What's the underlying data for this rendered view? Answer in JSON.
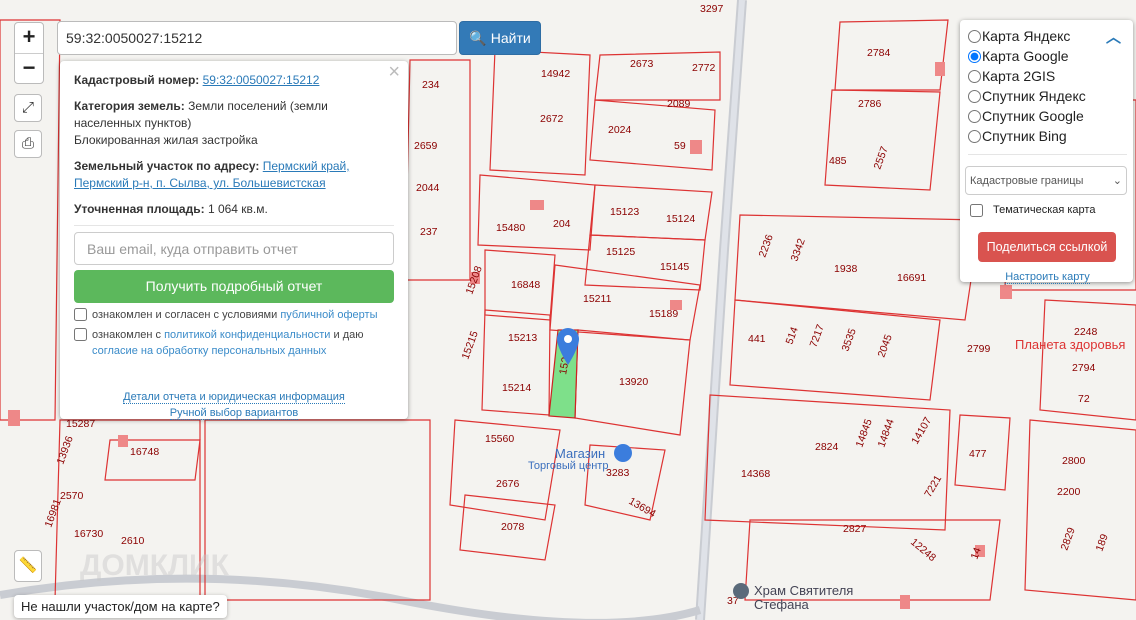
{
  "search": {
    "value": "59:32:0050027:15212",
    "button": "Найти"
  },
  "zoom": {
    "in": "+",
    "out": "−"
  },
  "popup": {
    "cad_label": "Кадастровый номер:",
    "cad_value": "59:32:0050027:15212",
    "cat_label": "Категория земель:",
    "cat_value": "Земли поселений (земли населенных пунктов)",
    "use": "Блокированная жилая застройка",
    "addr_label": "Земельный участок по адресу:",
    "addr_value": "Пермский край, Пермский р-н, п. Сылва, ул. Большевистская",
    "area_label": "Уточненная площадь:",
    "area_value": "1 064 кв.м.",
    "email_placeholder": "Ваш email, куда отправить отчет",
    "get_button": "Получить подробный отчет",
    "c1_text": "ознакомлен и согласен с условиями ",
    "c1_link": "публичной оферты",
    "c2_text": "ознакомлен с ",
    "c2_link": "политикой конфиденциальности",
    "c2_mid": " и даю ",
    "c2_link2": "согласие на обработку персональных данных",
    "details_link": "Детали отчета и юридическая информация",
    "manual_link": "Ручной выбор вариантов",
    "close": "×"
  },
  "layers": {
    "options": [
      "Карта Яндекс",
      "Карта Google",
      "Карта 2GIS",
      "Спутник Яндекс",
      "Спутник Google",
      "Спутник Bing"
    ],
    "selected": 1,
    "overlay": "Кадастровые границы",
    "thematic": "Тематическая карта",
    "share": "Поделиться ссылкой",
    "configure": "Настроить карту"
  },
  "map": {
    "parcels": [
      "3297",
      "2784",
      "2673",
      "2772",
      "14942",
      "234",
      "2089",
      "2786",
      "2672",
      "2024",
      "59",
      "2659",
      "485",
      "2557",
      "2044",
      "204",
      "15123",
      "15124",
      "15480",
      "237",
      "15125",
      "2236",
      "3342",
      "1938",
      "16691",
      "15145",
      "16848",
      "15211",
      "15208",
      "15189",
      "15213",
      "441",
      "514",
      "7217",
      "3535",
      "2045",
      "2799",
      "2248",
      "2794",
      "72",
      "15215",
      "13920",
      "15214",
      "15287",
      "16748",
      "13936",
      "15560",
      "2824",
      "14845",
      "14844",
      "14107",
      "477",
      "2800",
      "14368",
      "3283",
      "2676",
      "2570",
      "2200",
      "13694",
      "7221",
      "16981",
      "16730",
      "2610",
      "2078",
      "2827",
      "12248",
      "2829",
      "189",
      "14",
      "37",
      "152"
    ],
    "pois": [
      "Магазин",
      "Торговый центр",
      "Планета здоровья",
      "Храм Святителя",
      "Стефана"
    ],
    "watermark": "ДОМКЛИК"
  },
  "bottom": {
    "not_found": "Не нашли участок/дом на карте?"
  }
}
